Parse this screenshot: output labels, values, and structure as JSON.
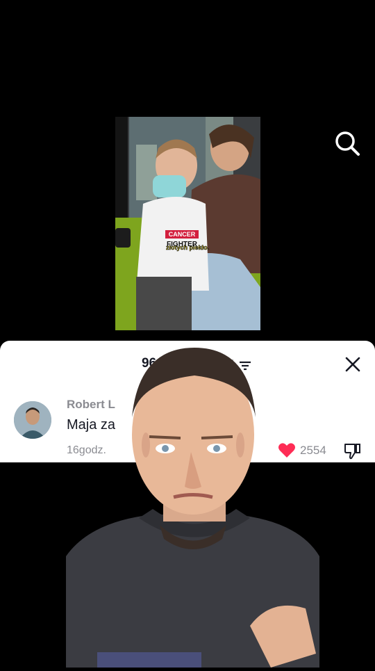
{
  "comments": {
    "count_label": "96 komentarzy",
    "items": [
      {
        "author": "Robert L",
        "text": "Maja za",
        "time": "16godz.",
        "likes": "2554"
      }
    ]
  },
  "video": {
    "shirt_text_line1": "CANCER",
    "shirt_text_line2": "FIGHTER",
    "caption": "złotych piekło."
  },
  "icons": {
    "search": "search-icon",
    "sort": "sort-icon",
    "close": "close-icon",
    "like": "heart-icon",
    "dislike": "thumbs-down-icon"
  },
  "colors": {
    "like": "#fe2c55",
    "sheet_bg": "#ffffff",
    "background": "#000000"
  }
}
